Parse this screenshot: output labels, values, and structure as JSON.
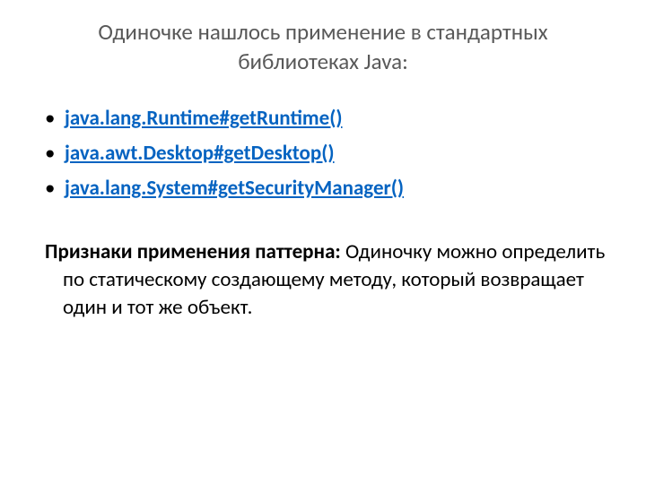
{
  "title": "Одиночке нашлось применение в стандартных библиотеках Java:",
  "links": [
    "java.lang.Runtime#getRuntime()",
    "java.awt.Desktop#getDesktop()",
    "java.lang.System#getSecurityManager()"
  ],
  "paragraph": {
    "label": "Признаки применения паттерна: ",
    "text": "Одиночку можно определить по статическому создающему методу, который возвращает один и тот же объект."
  }
}
